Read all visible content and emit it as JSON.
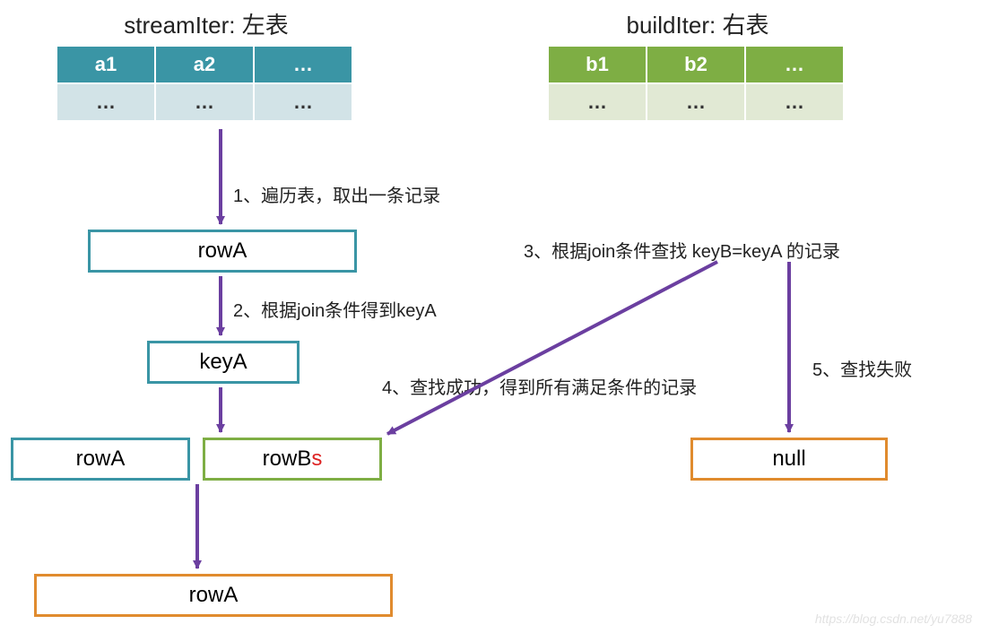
{
  "left": {
    "title": "streamIter: 左表",
    "headers": [
      "a1",
      "a2",
      "…"
    ],
    "row": [
      "…",
      "…",
      "…"
    ]
  },
  "right": {
    "title": "buildIter: 右表",
    "headers": [
      "b1",
      "b2",
      "…"
    ],
    "row": [
      "…",
      "…",
      "…"
    ]
  },
  "boxes": {
    "rowA1": "rowA",
    "keyA": "keyA",
    "rowA2": "rowA",
    "rowB_prefix": "rowB",
    "rowB_suffix": "s",
    "null": "null",
    "rowA3": "rowA"
  },
  "steps": {
    "s1": "1、遍历表，取出一条记录",
    "s2": "2、根据join条件得到keyA",
    "s3": "3、根据join条件查找 keyB=keyA 的记录",
    "s4": "4、查找成功，得到所有满足条件的记录",
    "s5": "5、查找失败"
  },
  "colors": {
    "arrow": "#6b3fa0",
    "teal": "#3a95a5",
    "green": "#7eae44",
    "orange": "#e08b2e"
  },
  "watermark": "https://blog.csdn.net/yu7888"
}
